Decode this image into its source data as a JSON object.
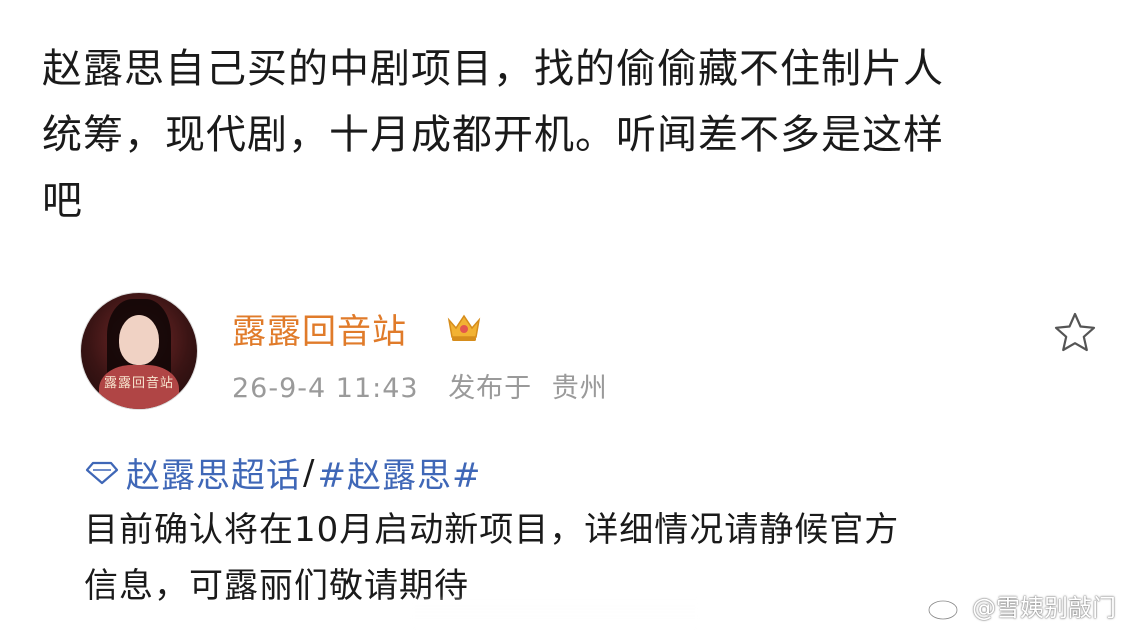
{
  "caption": {
    "line1": "赵露思自己买的中剧项目，找的偷偷藏不住制片人",
    "line2": "统筹，现代剧，十月成都开机。听闻差不多是这样",
    "line3": "吧"
  },
  "post": {
    "avatar_text": "露露回音站",
    "username": "露露回音站",
    "timestamp": "26-9-4 11:43",
    "published_prefix": "发布于",
    "location": "贵州",
    "topics": {
      "supertopic": "赵露思超话",
      "separator": "/",
      "hashtag": "#赵露思#"
    },
    "body_line1": "目前确认将在10月启动新项目，详细情况请静候官方",
    "body_line2": "信息，可露丽们敬请期待"
  },
  "watermark": {
    "text": "@雪姨别敲门"
  },
  "colors": {
    "username": "#e07b2a",
    "topic_link": "#3f67b7",
    "meta": "#9a9a9a",
    "text": "#1a1a1a",
    "crown": "#f2b233"
  },
  "icons": {
    "badge": "crown-icon",
    "favorite": "star-icon",
    "supertopic": "diamond-icon",
    "watermark": "weibo-logo-icon"
  }
}
